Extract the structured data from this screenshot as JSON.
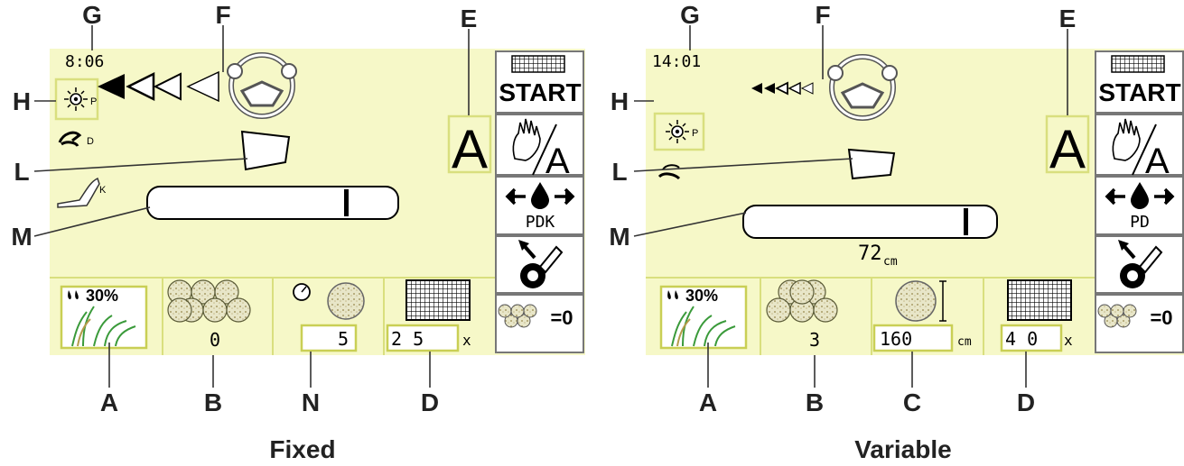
{
  "panels": [
    {
      "caption": "Fixed",
      "time": "8:06",
      "bale_count": "0",
      "pressure_value": "5",
      "net_layers": "2 5",
      "net_suffix": "x",
      "moisture": "30%",
      "lube_label": "PDK",
      "lube_label_small": "D",
      "tractor_pedal_label": "K",
      "mode_letter": "A",
      "start_label": "START",
      "reset_label": "=0",
      "callouts": [
        "G",
        "F",
        "E",
        "H",
        "L",
        "M",
        "A",
        "B",
        "N",
        "D"
      ]
    },
    {
      "caption": "Variable",
      "time": "14:01",
      "bale_count": "3",
      "diameter_value": "160",
      "diameter_unit": "cm",
      "net_layers": "4 0",
      "net_suffix": "x",
      "moisture": "30%",
      "lube_label": "PD",
      "bale_size_value": "72",
      "bale_size_unit": "cm",
      "mode_letter": "A",
      "start_label": "START",
      "reset_label": "=0",
      "callouts": [
        "G",
        "F",
        "E",
        "H",
        "L",
        "M",
        "A",
        "B",
        "C",
        "D"
      ]
    }
  ],
  "icons": [
    "arrow-left-filled-icon",
    "arrow-left-outline-icon",
    "steering-wheel-icon",
    "sun-p-icon",
    "tractor-d-icon",
    "pedal-k-icon",
    "hand-auto-icon",
    "oil-drop-icon",
    "grease-gun-icon",
    "bales-icon",
    "net-roll-icon",
    "grass-moisture-icon",
    "pressure-gauge-icon",
    "bale-diameter-icon"
  ]
}
